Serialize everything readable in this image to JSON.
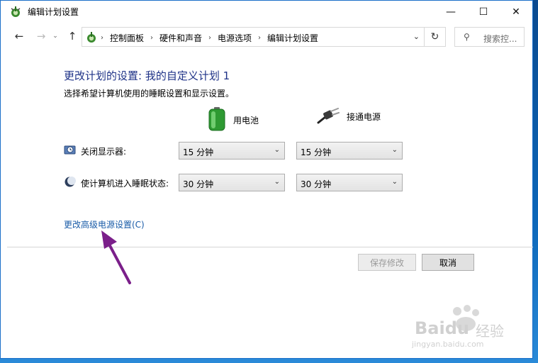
{
  "window": {
    "title": "编辑计划设置",
    "minimize_glyph": "—",
    "maximize_glyph": "☐",
    "close_glyph": "✕"
  },
  "nav": {
    "back_glyph": "←",
    "forward_glyph": "→",
    "recent_glyph": "⌄",
    "up_glyph": "↑",
    "breadcrumbs": [
      "控制面板",
      "硬件和声音",
      "电源选项",
      "编辑计划设置"
    ],
    "crumb_separator": "›",
    "dropdown_glyph": "⌄",
    "refresh_glyph": "↻",
    "search_placeholder": "搜索控...",
    "search_glyph": "⚲"
  },
  "content": {
    "heading": "更改计划的设置: 我的自定义计划 1",
    "subtext": "选择希望计算机使用的睡眠设置和显示设置。",
    "columns": {
      "battery": "用电池",
      "plugged_in": "接通电源"
    },
    "rows": {
      "display_off": {
        "label": "关闭显示器:",
        "battery_value": "15 分钟",
        "plugged_value": "15 分钟"
      },
      "sleep": {
        "label": "使计算机进入睡眠状态:",
        "battery_value": "30 分钟",
        "plugged_value": "30 分钟"
      }
    },
    "select_chevron": "⌄",
    "advanced_link": "更改高级电源设置(C)"
  },
  "buttons": {
    "save": "保存修改",
    "cancel": "取消"
  },
  "watermark": {
    "brand": "Baidu",
    "brand_cn": "经验",
    "url": "jingyan.baidu.com"
  },
  "colors": {
    "heading": "#1e3287",
    "link": "#1a5ca8",
    "annotation_arrow": "#7b1f8a"
  },
  "icons": {
    "title": "power-options-icon",
    "address": "power-options-icon",
    "battery": "battery-icon",
    "plugged_in": "power-plug-icon",
    "display_off": "monitor-clock-icon",
    "sleep": "moon-icon"
  }
}
